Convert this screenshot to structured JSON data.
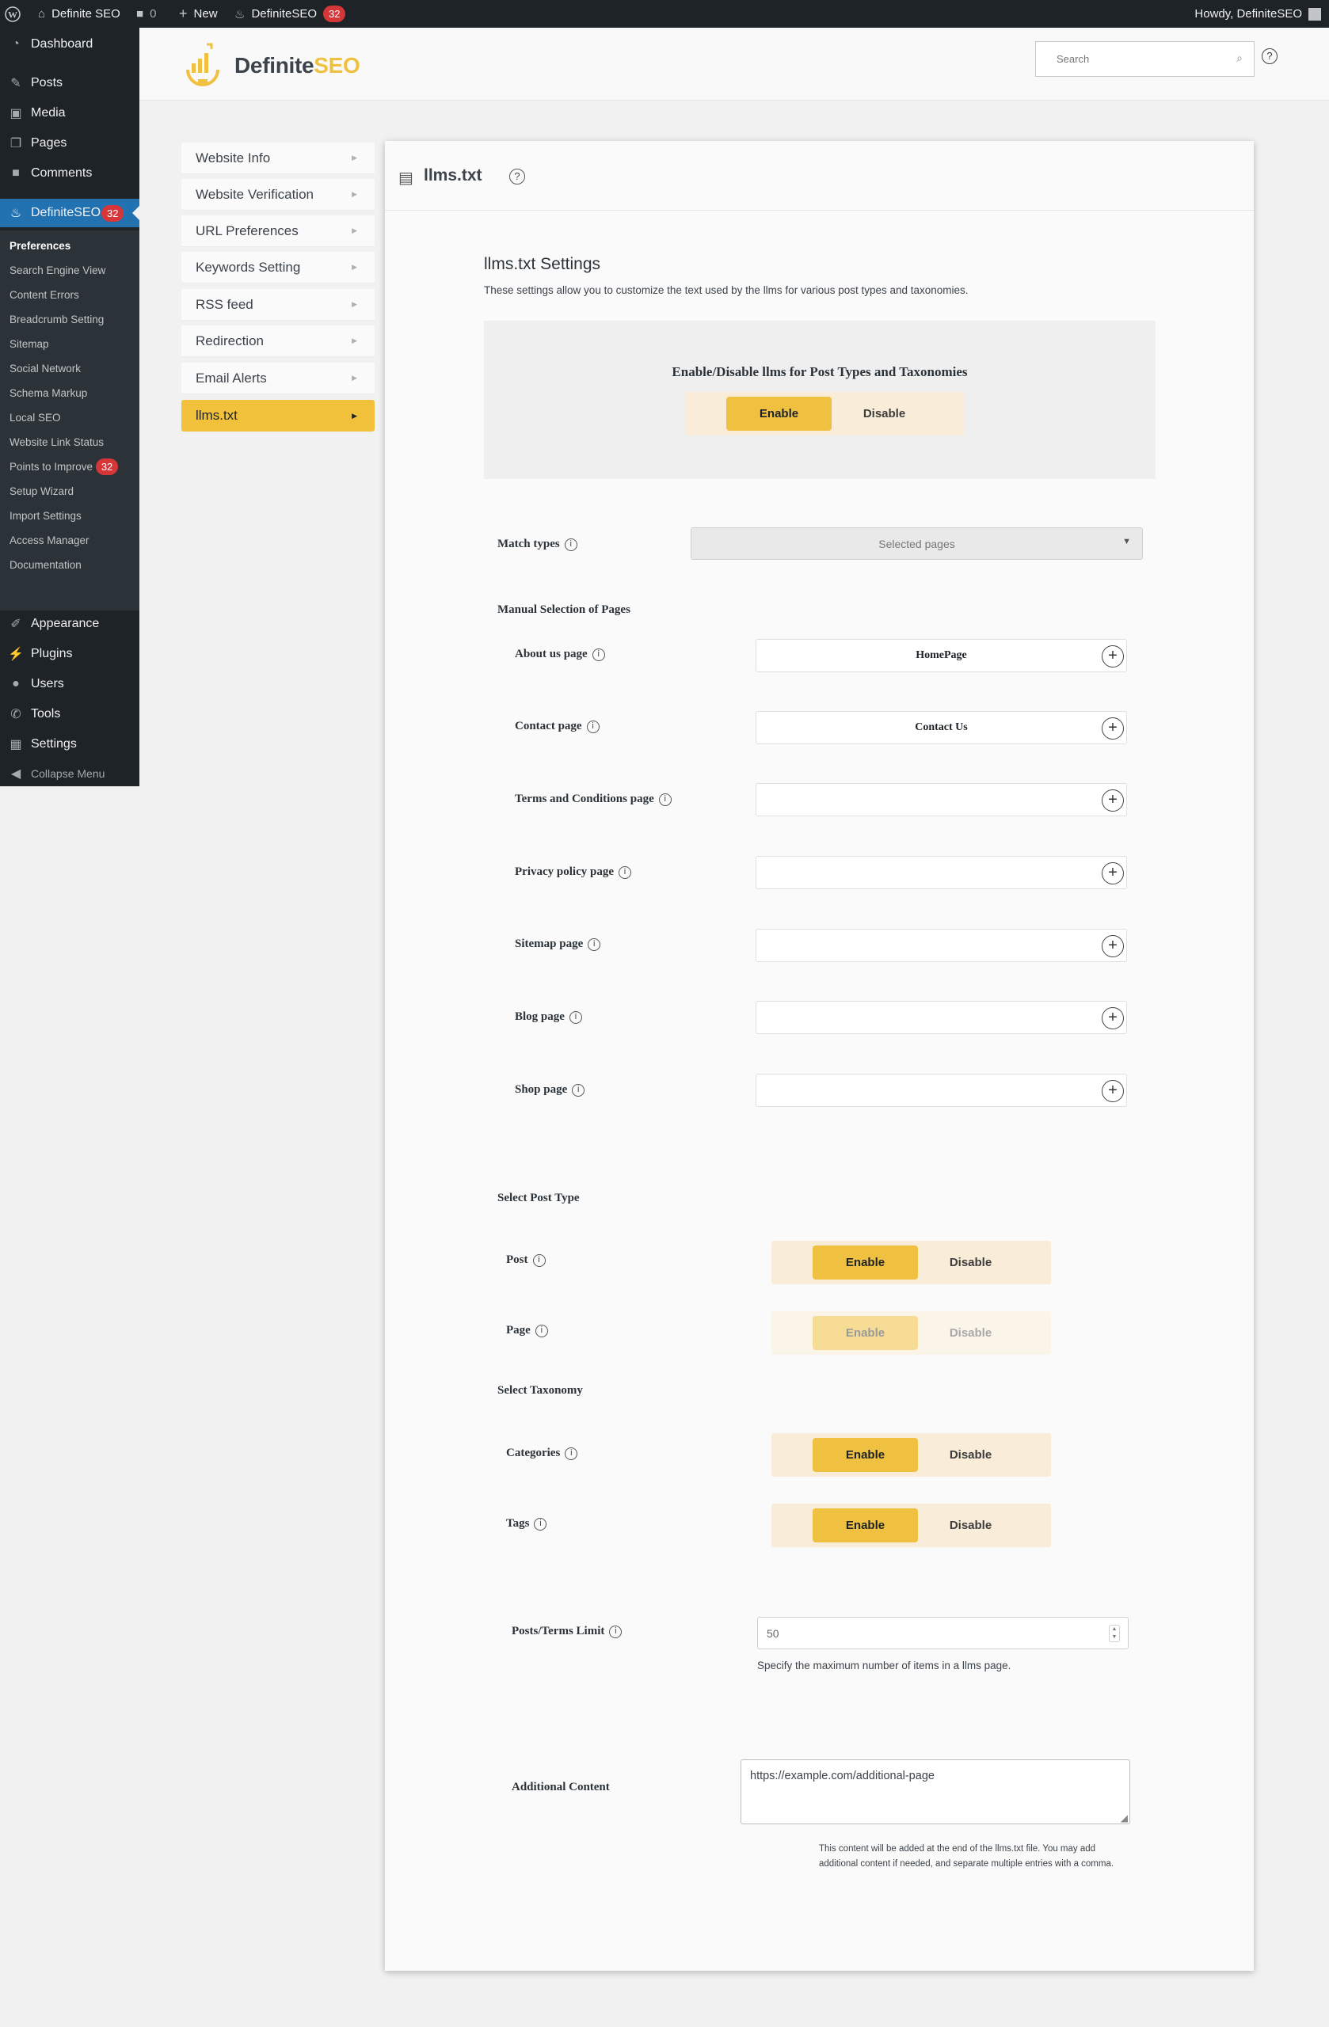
{
  "adminbar": {
    "site_name": "Definite SEO",
    "comments_count": "0",
    "new_label": "New",
    "plugin_name": "DefiniteSEO",
    "plugin_badge": "32",
    "howdy": "Howdy, DefiniteSEO"
  },
  "sidebar": {
    "dashboard": "Dashboard",
    "posts": "Posts",
    "media": "Media",
    "pages": "Pages",
    "comments": "Comments",
    "definiteseo": "DefiniteSEO",
    "definiteseo_badge": "32",
    "submenu": [
      {
        "label": "Preferences"
      },
      {
        "label": "Search Engine View"
      },
      {
        "label": "Content Errors"
      },
      {
        "label": "Breadcrumb Setting"
      },
      {
        "label": "Sitemap"
      },
      {
        "label": "Social Network"
      },
      {
        "label": "Schema Markup"
      },
      {
        "label": "Local SEO"
      },
      {
        "label": "Website Link Status"
      },
      {
        "label": "Points to Improve",
        "badge": "32"
      },
      {
        "label": "Setup Wizard"
      },
      {
        "label": "Import Settings"
      },
      {
        "label": "Access Manager"
      },
      {
        "label": "Documentation"
      }
    ],
    "appearance": "Appearance",
    "plugins": "Plugins",
    "users": "Users",
    "tools": "Tools",
    "settings": "Settings",
    "collapse": "Collapse Menu"
  },
  "header": {
    "logo_main": "Definite",
    "logo_accent": "SEO",
    "search_placeholder": "Search"
  },
  "settings_menu": [
    {
      "label": "Website Info"
    },
    {
      "label": "Website Verification"
    },
    {
      "label": "URL Preferences"
    },
    {
      "label": "Keywords Setting"
    },
    {
      "label": "RSS feed"
    },
    {
      "label": "Redirection"
    },
    {
      "label": "Email Alerts"
    },
    {
      "label": "llms.txt"
    }
  ],
  "panel": {
    "title": "llms.txt",
    "section_title": "llms.txt Settings",
    "section_desc": "These settings allow you to customize the text used by the llms for various post types and taxonomies.",
    "toggle_heading": "Enable/Disable llms for Post Types and Taxonomies",
    "enable": "Enable",
    "disable": "Disable",
    "match_types_label": "Match types",
    "match_types_value": "Selected pages",
    "manual_selection": "Manual Selection of Pages",
    "pages": [
      {
        "label": "About us page",
        "value": "HomePage"
      },
      {
        "label": "Contact page",
        "value": "Contact Us"
      },
      {
        "label": "Terms and Conditions page",
        "value": ""
      },
      {
        "label": "Privacy policy page",
        "value": ""
      },
      {
        "label": "Sitemap page",
        "value": ""
      },
      {
        "label": "Blog page",
        "value": ""
      },
      {
        "label": "Shop page",
        "value": ""
      }
    ],
    "select_post_type": "Select Post Type",
    "post_label": "Post",
    "page_label": "Page",
    "select_taxonomy": "Select Taxonomy",
    "categories_label": "Categories",
    "tags_label": "Tags",
    "limit_label": "Posts/Terms Limit",
    "limit_value": "50",
    "limit_help": "Specify the maximum number of items in a llms page.",
    "additional_label": "Additional Content",
    "additional_value": "https://example.com/additional-page",
    "additional_help": "This content will be added at the end of the llms.txt file. You may add additional content if needed, and separate multiple entries with a comma."
  },
  "colors": {
    "accent": "#f0c040",
    "admin_bg": "#1d2327",
    "active_blue": "#2271b1",
    "badge_red": "#d63638"
  }
}
